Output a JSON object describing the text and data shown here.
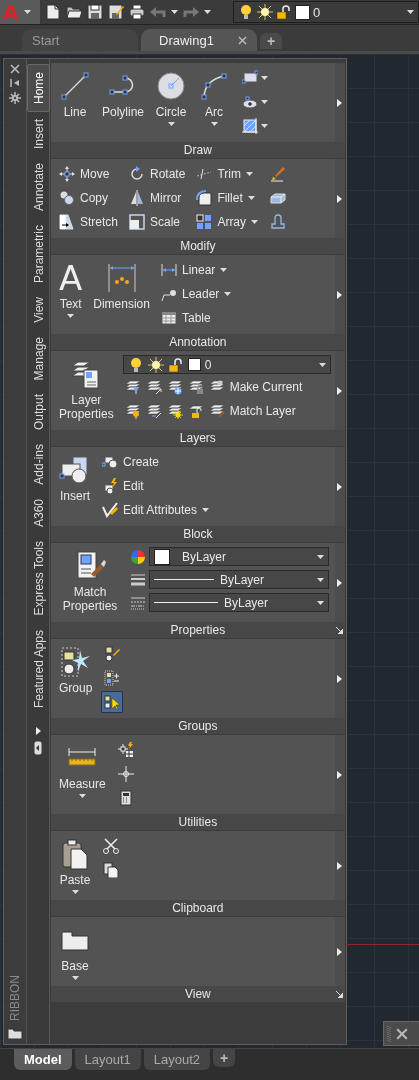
{
  "app": {
    "logo": "A"
  },
  "quick_access": {
    "layer": "0"
  },
  "doc_tabs": [
    {
      "label": "Start",
      "selected": false,
      "closable": false
    },
    {
      "label": "Drawing1",
      "selected": true,
      "closable": true
    }
  ],
  "new_tab": "+",
  "ribbon": {
    "title": "RIBBON",
    "tabs": [
      {
        "label": "Home",
        "selected": true
      },
      {
        "label": "Insert",
        "selected": false
      },
      {
        "label": "Annotate",
        "selected": false
      },
      {
        "label": "Parametric",
        "selected": false
      },
      {
        "label": "View",
        "selected": false
      },
      {
        "label": "Manage",
        "selected": false
      },
      {
        "label": "Output",
        "selected": false
      },
      {
        "label": "Add-ins",
        "selected": false
      },
      {
        "label": "A360",
        "selected": false
      },
      {
        "label": "Express Tools",
        "selected": false
      },
      {
        "label": "Featured Apps",
        "selected": false
      }
    ],
    "panels": [
      {
        "title": "Draw",
        "launcher": false,
        "columns": [
          {
            "items": [
              {
                "kind": "large",
                "label": "Line",
                "menu": false
              }
            ]
          },
          {
            "items": [
              {
                "kind": "large",
                "label": "Polyline",
                "menu": false
              }
            ]
          },
          {
            "items": [
              {
                "kind": "large",
                "label": "Circle",
                "menu": true
              }
            ]
          },
          {
            "items": [
              {
                "kind": "large",
                "label": "Arc",
                "menu": true
              }
            ]
          },
          {
            "items": [
              {
                "kind": "icon",
                "menu": true
              },
              {
                "kind": "icon",
                "menu": true
              },
              {
                "kind": "icon",
                "menu": true
              }
            ]
          }
        ]
      },
      {
        "title": "Modify",
        "launcher": false,
        "columns": [
          {
            "items": [
              {
                "kind": "small",
                "label": "Move",
                "menu": false
              },
              {
                "kind": "small",
                "label": "Copy",
                "menu": false
              },
              {
                "kind": "small",
                "label": "Stretch",
                "menu": false
              }
            ]
          },
          {
            "items": [
              {
                "kind": "small",
                "label": "Rotate",
                "menu": false
              },
              {
                "kind": "small",
                "label": "Mirror",
                "menu": false
              },
              {
                "kind": "small",
                "label": "Scale",
                "menu": false
              }
            ]
          },
          {
            "items": [
              {
                "kind": "small",
                "label": "Trim",
                "menu": true
              },
              {
                "kind": "small",
                "label": "Fillet",
                "menu": true
              },
              {
                "kind": "small",
                "label": "Array",
                "menu": true
              }
            ]
          },
          {
            "items": [
              {
                "kind": "icon",
                "menu": false
              },
              {
                "kind": "icon",
                "menu": false
              },
              {
                "kind": "icon",
                "menu": false
              }
            ]
          }
        ]
      },
      {
        "title": "Annotation",
        "launcher": false,
        "columns": [
          {
            "items": [
              {
                "kind": "large",
                "label": "Text",
                "glyph": "A",
                "menu": true
              }
            ]
          },
          {
            "items": [
              {
                "kind": "large",
                "label": "Dimension",
                "menu": false
              }
            ]
          },
          {
            "items": [
              {
                "kind": "small",
                "label": "Linear",
                "menu": true
              },
              {
                "kind": "small",
                "label": "Leader",
                "menu": true
              },
              {
                "kind": "small",
                "label": "Table",
                "menu": false
              }
            ]
          }
        ]
      },
      {
        "title": "Layers",
        "launcher": false,
        "columns": [
          {
            "items": [
              {
                "kind": "large",
                "label": "Layer Properties",
                "menu": false
              }
            ]
          },
          {
            "items": [
              {
                "kind": "layercombo",
                "value": "0"
              },
              {
                "kind": "tools",
                "label": "Make Current"
              },
              {
                "kind": "tools",
                "label": "Match Layer"
              }
            ]
          }
        ]
      },
      {
        "title": "Block",
        "launcher": false,
        "columns": [
          {
            "items": [
              {
                "kind": "large",
                "label": "Insert",
                "menu": false
              }
            ]
          },
          {
            "items": [
              {
                "kind": "small",
                "label": "Create",
                "menu": false
              },
              {
                "kind": "small",
                "label": "Edit",
                "menu": false
              },
              {
                "kind": "small",
                "label": "Edit Attributes",
                "menu": true
              }
            ]
          }
        ]
      },
      {
        "title": "Properties",
        "launcher": true,
        "columns": [
          {
            "items": [
              {
                "kind": "large",
                "label": "Match Properties",
                "menu": false
              }
            ]
          },
          {
            "items": [
              {
                "kind": "colorcombo",
                "value": "ByLayer"
              },
              {
                "kind": "linecombo",
                "value": "ByLayer"
              },
              {
                "kind": "linecombo",
                "value": "ByLayer"
              }
            ]
          }
        ]
      },
      {
        "title": "Groups",
        "launcher": false,
        "columns": [
          {
            "items": [
              {
                "kind": "large",
                "label": "Group",
                "menu": false
              }
            ]
          },
          {
            "items": [
              {
                "kind": "icon",
                "menu": false,
                "on": false
              },
              {
                "kind": "icon",
                "menu": false,
                "on": false
              },
              {
                "kind": "icon",
                "menu": false,
                "on": true
              }
            ]
          }
        ]
      },
      {
        "title": "Utilities",
        "launcher": false,
        "columns": [
          {
            "items": [
              {
                "kind": "large",
                "label": "Measure",
                "menu": true
              }
            ]
          },
          {
            "items": [
              {
                "kind": "icon",
                "menu": false
              },
              {
                "kind": "icon",
                "menu": false
              },
              {
                "kind": "icon",
                "menu": false
              }
            ]
          }
        ]
      },
      {
        "title": "Clipboard",
        "launcher": false,
        "columns": [
          {
            "items": [
              {
                "kind": "large",
                "label": "Paste",
                "menu": true
              }
            ]
          },
          {
            "items": [
              {
                "kind": "icon",
                "menu": false
              },
              {
                "kind": "icon",
                "menu": false
              }
            ]
          }
        ]
      },
      {
        "title": "View",
        "launcher": true,
        "columns": [
          {
            "items": [
              {
                "kind": "large",
                "label": "Base",
                "menu": true
              }
            ]
          }
        ]
      }
    ]
  },
  "layout_tabs": [
    {
      "label": "Model",
      "selected": true
    },
    {
      "label": "Layout1",
      "selected": false
    },
    {
      "label": "Layout2",
      "selected": false
    }
  ],
  "new_layout": "+"
}
